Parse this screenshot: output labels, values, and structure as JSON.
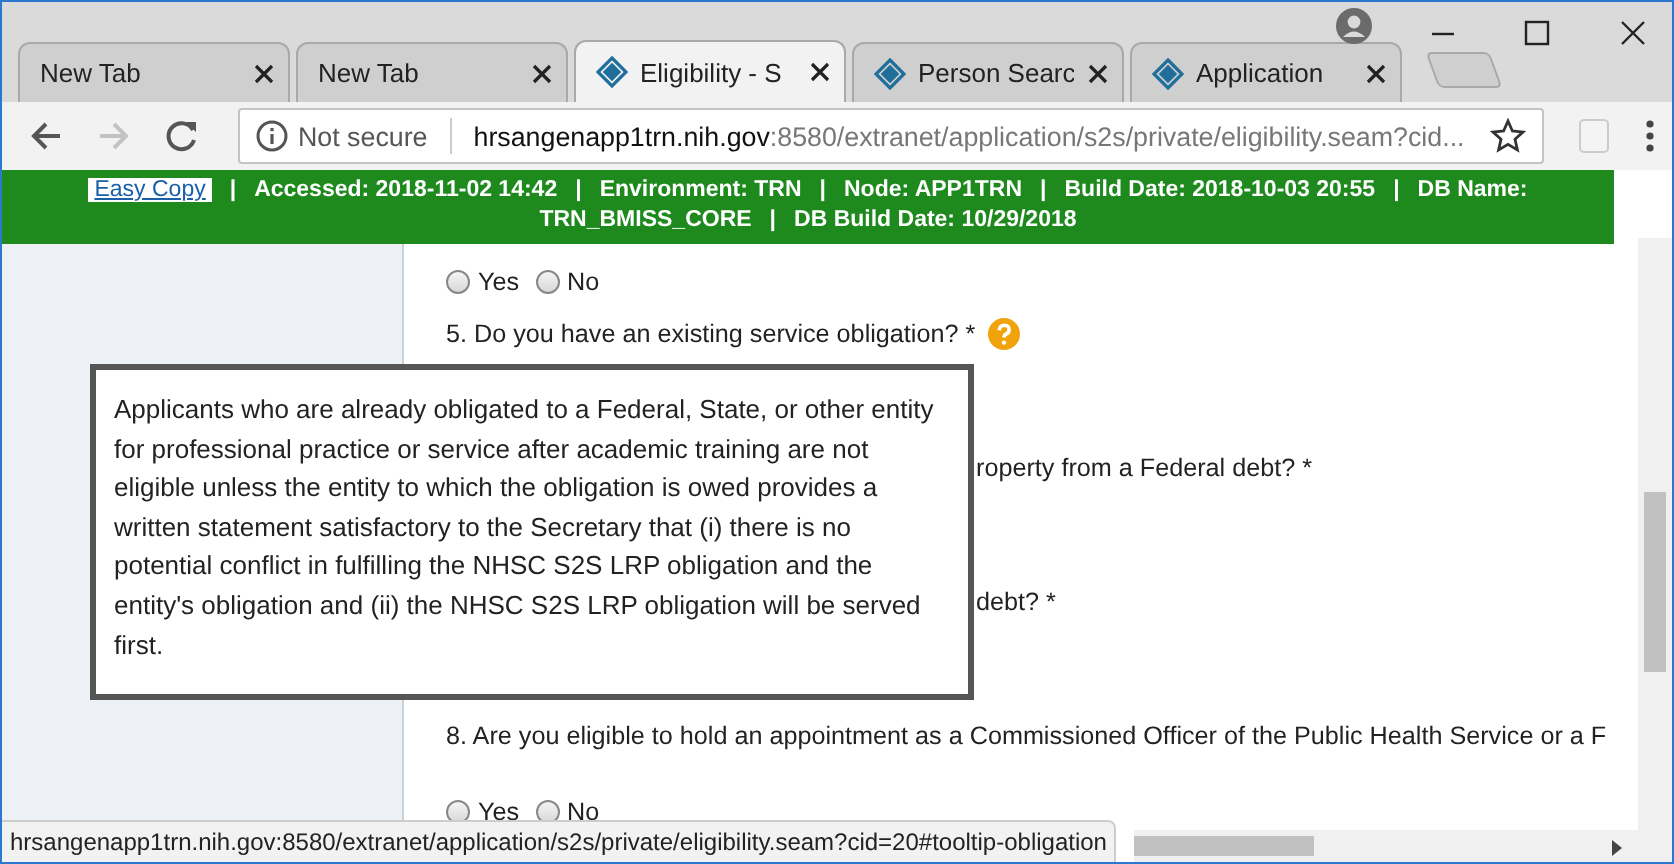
{
  "tabs": [
    {
      "title": "New Tab",
      "kind": "blank",
      "selected": false
    },
    {
      "title": "New Tab",
      "kind": "blank",
      "selected": false
    },
    {
      "title": "Eligibility - S",
      "kind": "site",
      "selected": true
    },
    {
      "title": "Person Searc",
      "kind": "site",
      "selected": false
    },
    {
      "title": "Application",
      "kind": "site",
      "selected": false
    }
  ],
  "nav": [
    {
      "kind": "back",
      "disabled": false
    },
    {
      "kind": "forward",
      "disabled": true
    },
    {
      "kind": "reload",
      "disabled": false
    }
  ],
  "address": {
    "security": "Not secure",
    "host": "hrsangenapp1trn.nih.gov",
    "path": ":8580/extranet/application/s2s/private/eligibility.seam?cid..."
  },
  "banner": {
    "link": "Easy Copy",
    "separator": "|",
    "items": [
      "Accessed: 2018-11-02 14:42",
      "Environment: TRN",
      "Node: APP1TRN",
      "Build Date: 2018-10-03 20:55",
      "DB Name: TRN_BMISS_CORE",
      "DB Build Date: 10/29/2018"
    ]
  },
  "content": [
    {
      "kind": "radios",
      "options": [
        {
          "label": "Yes",
          "selected": false
        },
        {
          "label": "No",
          "selected": false
        }
      ]
    },
    {
      "kind": "question",
      "text": "5. Do you have an existing service obligation? *",
      "help": true
    },
    {
      "kind": "partial",
      "text": "roperty from a Federal debt? *"
    },
    {
      "kind": "partial",
      "text": "debt? *"
    },
    {
      "kind": "question",
      "text": "8. Are you eligible to hold an appointment as a Commissioned Officer of the Public Health Service or a F",
      "help": false
    },
    {
      "kind": "radios",
      "options": [
        {
          "label": "Yes",
          "selected": false
        },
        {
          "label": "No",
          "selected": false
        }
      ]
    }
  ],
  "tooltip": "Applicants who are already obligated to a Federal, State, or other entity for professional practice or service after academic training are not eligible unless the entity to which the obligation is owed provides a written statement satisfactory to the Secretary that (i) there is no potential conflict in fulfilling the NHSC S2S LRP obligation and the entity's obligation and (ii) the NHSC S2S LRP obligation will be served first.",
  "status_url": "hrsangenapp1trn.nih.gov:8580/extranet/application/s2s/private/eligibility.seam?cid=20#tooltip-obligation"
}
